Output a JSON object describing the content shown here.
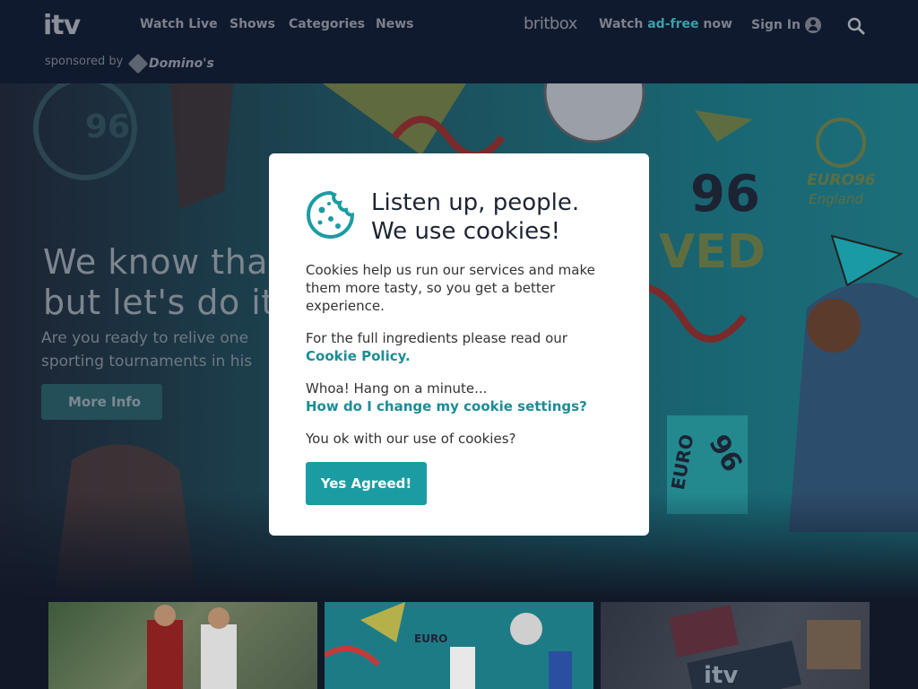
{
  "header": {
    "logo_text": "itv",
    "nav": [
      "Watch Live",
      "Shows",
      "Categories",
      "News"
    ],
    "britbox": "britbox",
    "adfree": {
      "prefix": "Watch ",
      "highlight": "ad-free",
      "suffix": " now"
    },
    "sign_in": "Sign In",
    "sponsored_by": "sponsored by",
    "sponsor_name": "Domino's"
  },
  "hero": {
    "title_line1": "We know that",
    "title_line2": "but let's do it a",
    "sub_line1": "Are you ready to relive one",
    "sub_line2": "sporting tournaments in his",
    "more_info": "More Info",
    "graphic_96": "96",
    "graphic_ved": "VED",
    "graphic_euro96": "EURO96",
    "graphic_england": "England",
    "graphic_euro_vertical": "EURO",
    "graphic_96_small": "96"
  },
  "modal": {
    "title_line1": "Listen up, people.",
    "title_line2": "We use cookies!",
    "para1": [
      "Cookies help us run our services and make",
      "them more tasty, so you get a better",
      "experience."
    ],
    "para2": "For the full ingredients please read our",
    "cookie_policy_link": "Cookie Policy.",
    "para3": "Whoa! Hang on a minute...",
    "settings_link": "How do I change my cookie settings?",
    "para4": "You ok with our use of cookies?",
    "yes_button": "Yes Agreed!"
  },
  "colors": {
    "accent": "#1b9ca3",
    "header_bg": "#101a2e",
    "page_bg": "#111827"
  }
}
